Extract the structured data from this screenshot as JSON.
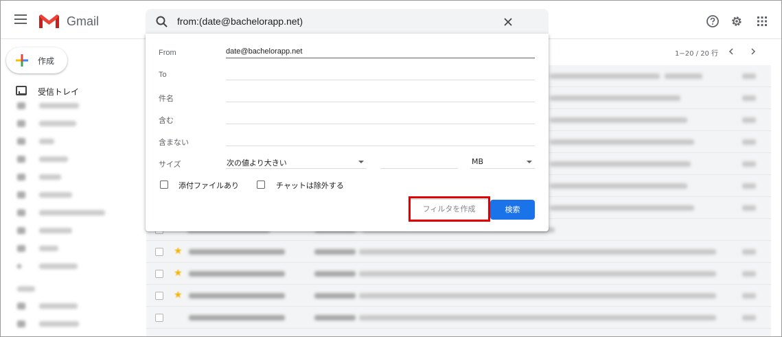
{
  "app": {
    "name": "Gmail"
  },
  "search": {
    "query": "from:(date@bachelorapp.net)"
  },
  "sidebar": {
    "compose_label": "作成",
    "inbox_label": "受信トレイ"
  },
  "pager": {
    "range": "1−20 / 20 行"
  },
  "search_panel": {
    "from_label": "From",
    "from_value": "date@bachelorapp.net",
    "to_label": "To",
    "subject_label": "件名",
    "has_words_label": "含む",
    "no_words_label": "含まない",
    "size_label": "サイズ",
    "size_operator": "次の値より大きい",
    "size_unit": "MB",
    "attachment_label": "添付ファイルあり",
    "exclude_chats_label": "チャットは除外する",
    "create_filter_label": "フィルタを作成",
    "search_button_label": "検索"
  },
  "colors": {
    "primary_blue": "#1a73e8",
    "highlight_red": "#e00000",
    "gmail_red": "#EA4335"
  }
}
